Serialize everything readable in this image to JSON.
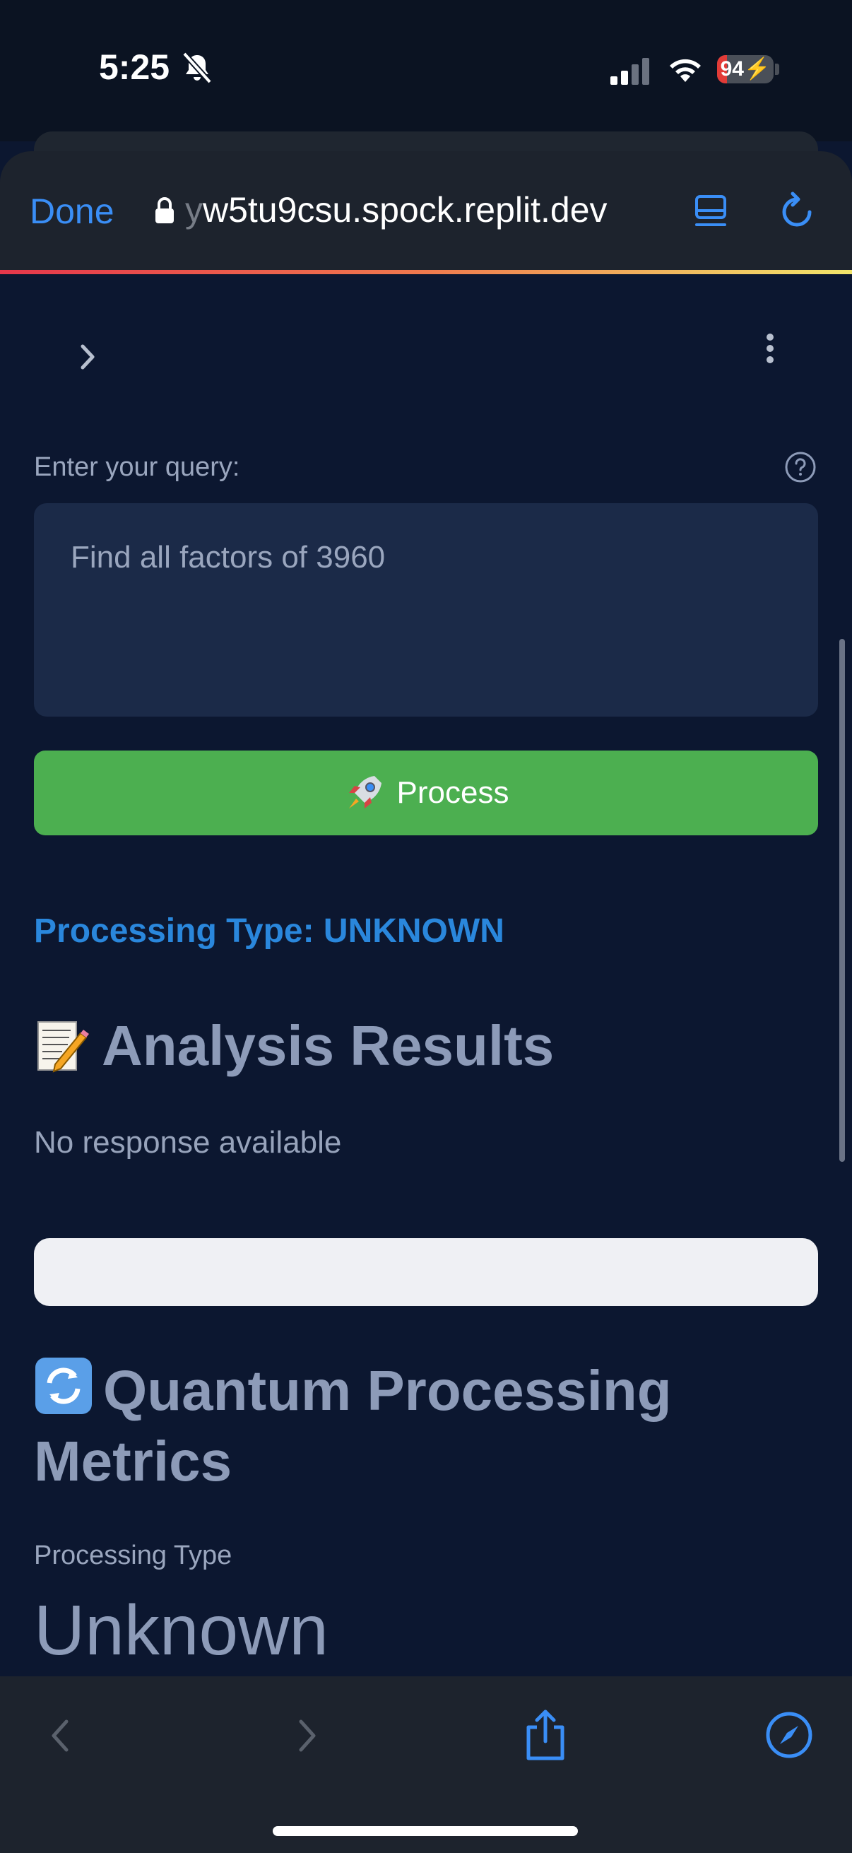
{
  "status_bar": {
    "time": "5:25",
    "battery": "94"
  },
  "browser": {
    "done_label": "Done",
    "url_dim": "y",
    "url": "w5tu9csu.spock.replit.dev"
  },
  "form": {
    "query_label": "Enter your query:",
    "query_value": "Find all factors of 3960",
    "process_label": "Process"
  },
  "results": {
    "processing_type_line": "Processing Type: UNKNOWN",
    "analysis_title": "Analysis Results",
    "no_response": "No response available"
  },
  "metrics": {
    "title": "Quantum Processing Metrics",
    "processing_type_label": "Processing Type",
    "processing_type_value": "Unknown"
  },
  "colors": {
    "accent": "#3a8ef6",
    "process_button": "#4caf50",
    "processing_type_text": "#2a87dc",
    "background": "#0c1730"
  },
  "icons": [
    "bell-slash-icon",
    "signal-icon",
    "wifi-icon",
    "battery-icon",
    "lock-icon",
    "reader-icon",
    "reload-icon",
    "chevron-right-icon",
    "kebab-menu-icon",
    "help-icon",
    "rocket-icon",
    "memo-icon",
    "cycle-icon",
    "back-icon",
    "forward-icon",
    "share-icon",
    "compass-icon"
  ]
}
